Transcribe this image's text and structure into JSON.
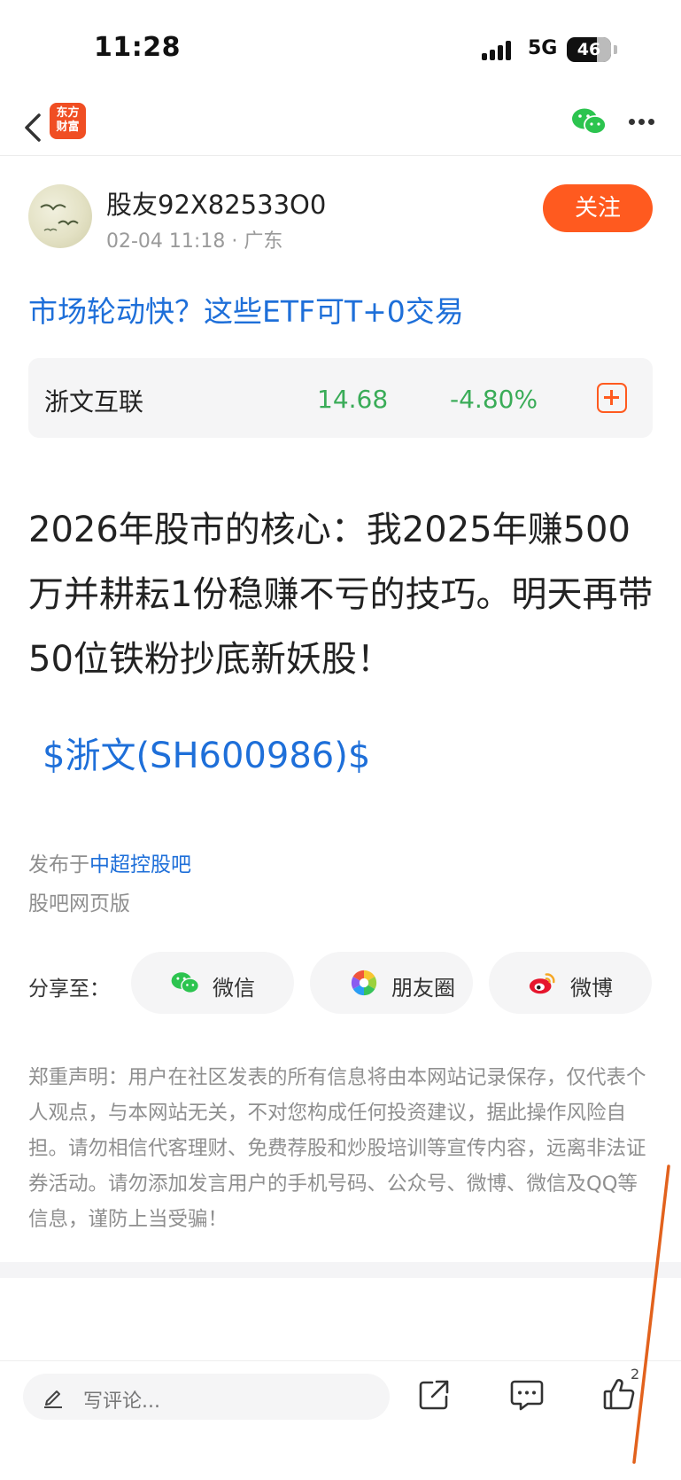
{
  "status_bar": {
    "time": "11:28",
    "network": "5G",
    "battery": "46"
  },
  "nav": {
    "logo_text": "东方财富",
    "logo_line1": "东方",
    "logo_line2": "财富",
    "back_icon": "chevron-left-icon",
    "wechat_icon": "wechat-icon",
    "more_icon": "more-icon"
  },
  "author": {
    "name": "股友92X82533O0",
    "date": "02-04 11:18",
    "location": "广东",
    "follow_label": "关注"
  },
  "headline_link": "市场轮动快？这些ETF可T+0交易",
  "stock_card": {
    "name": "浙文互联",
    "price": "14.68",
    "change": "-4.80%",
    "change_color": "#3aac58"
  },
  "post": {
    "body": "2026年股市的核心：我2025年赚500万并耕耘1份稳赚不亏的技巧。明天再带50位铁粉抄底新妖股！",
    "stock_tag": "$浙文(SH600986)$"
  },
  "published": {
    "prefix": "发布于",
    "bar_name": "中超控股吧",
    "version": "股吧网页版"
  },
  "share": {
    "label": "分享至：",
    "options": [
      {
        "label": "微信",
        "icon": "wechat-icon"
      },
      {
        "label": "朋友圈",
        "icon": "moments-icon"
      },
      {
        "label": "微博",
        "icon": "weibo-icon"
      }
    ]
  },
  "disclaimer": "郑重声明：用户在社区发表的所有信息将由本网站记录保存，仅代表个人观点，与本网站无关，不对您构成任何投资建议，据此操作风险自担。请勿相信代客理财、免费荐股和炒股培训等宣传内容，远离非法证券活动。请勿添加发言用户的手机号码、公众号、微博、微信及QQ等信息，谨防上当受骗！",
  "bottom_bar": {
    "comment_placeholder": "写评论...",
    "like_count": "2"
  },
  "colors": {
    "accent": "#ff5a1f",
    "link": "#1e6fd9",
    "down": "#3aac58"
  }
}
